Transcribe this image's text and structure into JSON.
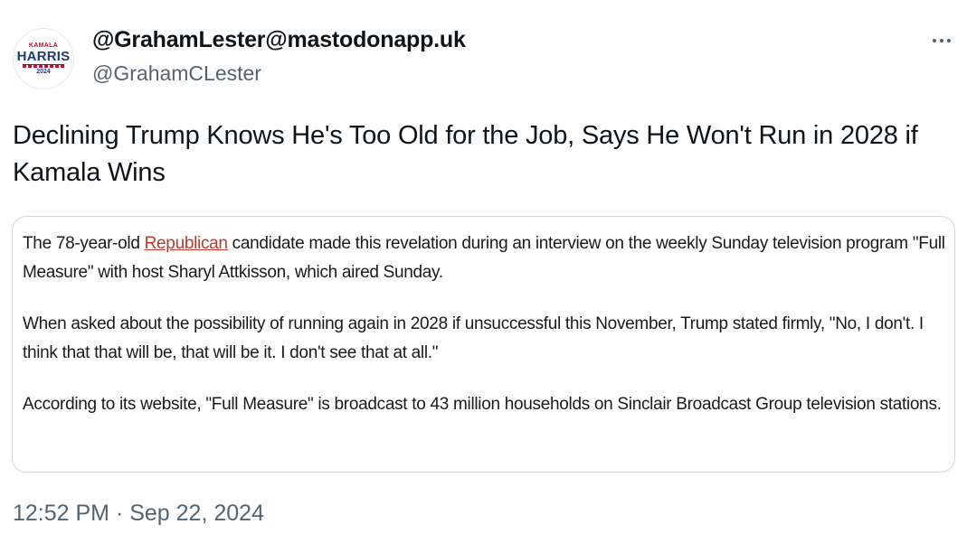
{
  "author": {
    "display_name": "@GrahamLester@mastodonapp.uk",
    "handle": "@GrahamCLester",
    "avatar": {
      "line1": "KAMALA",
      "line2": "HARRIS",
      "line3": "2024"
    }
  },
  "post": {
    "text": "Declining Trump Knows He's Too Old for the Job, Says He Won't Run in 2028 if Kamala Wins",
    "timestamp": "12:52 PM · Sep 22, 2024"
  },
  "quote": {
    "p1_before": "The 78-year-old ",
    "p1_link": "Republican",
    "p1_after": " candidate made this revelation during an interview on the weekly Sunday television program \"Full Measure\" with host Sharyl Attkisson, which aired Sunday.",
    "p2": "When asked about the possibility of running again in 2028 if unsuccessful this November, Trump stated firmly, \"No, I don't. I think that that will be, that will be it. I don't see that at all.\"",
    "p3": "According to its website, \"Full Measure\" is broadcast to 43 million households on Sinclair Broadcast Group television stations."
  },
  "icons": {
    "more": "more-horizontal-icon"
  },
  "colors": {
    "link": "#c0392b",
    "secondary_text": "#536471",
    "border": "#cfd9de"
  }
}
